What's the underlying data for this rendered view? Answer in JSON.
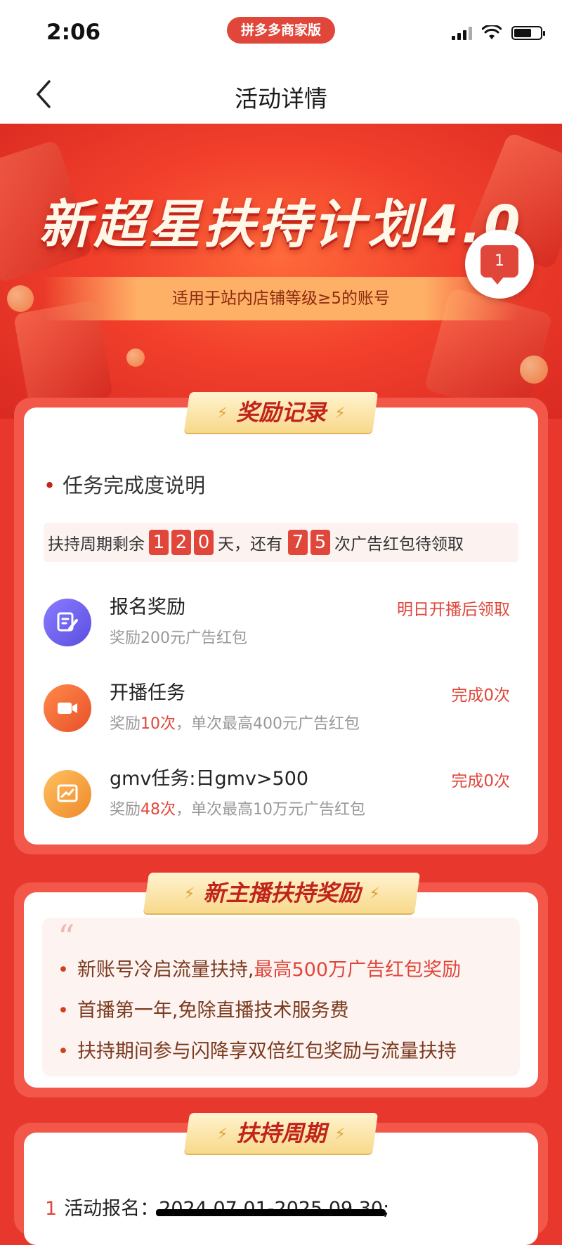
{
  "status": {
    "time": "2:06",
    "app_pill": "拼多多商家版"
  },
  "nav": {
    "title": "活动详情"
  },
  "hero": {
    "title": "新超星扶持计划4.0",
    "subtitle": "适用于站内店铺等级≥5的账号",
    "message_count": "1"
  },
  "rewards": {
    "ribbon": "奖励记录",
    "section_title": "任务完成度说明",
    "period": {
      "prefix": "扶持周期剩余",
      "days": [
        "1",
        "2",
        "0"
      ],
      "mid": "天，还有",
      "times": [
        "7",
        "5"
      ],
      "suffix": "次广告红包待领取"
    },
    "tasks": [
      {
        "title": "报名奖励",
        "sub_plain": "奖励200元广告红包",
        "status": "明日开播后领取",
        "icon": "edit-icon",
        "color": "#7066f0"
      },
      {
        "title": "开播任务",
        "sub_a": "奖励",
        "sub_hl": "10次",
        "sub_b": "，单次最高400元广告红包",
        "status": "完成0次",
        "icon": "video-icon",
        "color": "#f06a3a"
      },
      {
        "title": "gmv任务:日gmv>500",
        "sub_a": "奖励",
        "sub_hl": "48次",
        "sub_b": "，单次最高10万元广告红包",
        "status": "完成0次",
        "icon": "chart-icon",
        "color": "#f0a040"
      }
    ]
  },
  "new_anchor": {
    "ribbon": "新主播扶持奖励",
    "bullets": [
      {
        "a": "新账号冷启流量扶持,",
        "hl": "最高500万广告红包奖励"
      },
      {
        "a": "首播第一年,免除直播技术服务费",
        "hl": ""
      },
      {
        "a": "扶持期间参与闪降享双倍红包奖励与流量扶持",
        "hl": ""
      }
    ]
  },
  "support_period": {
    "ribbon": "扶持周期",
    "steps": [
      {
        "n": "1",
        "label": "活动报名：",
        "value": "2024.07.01-2025.09.30",
        "tail": ";"
      }
    ]
  }
}
